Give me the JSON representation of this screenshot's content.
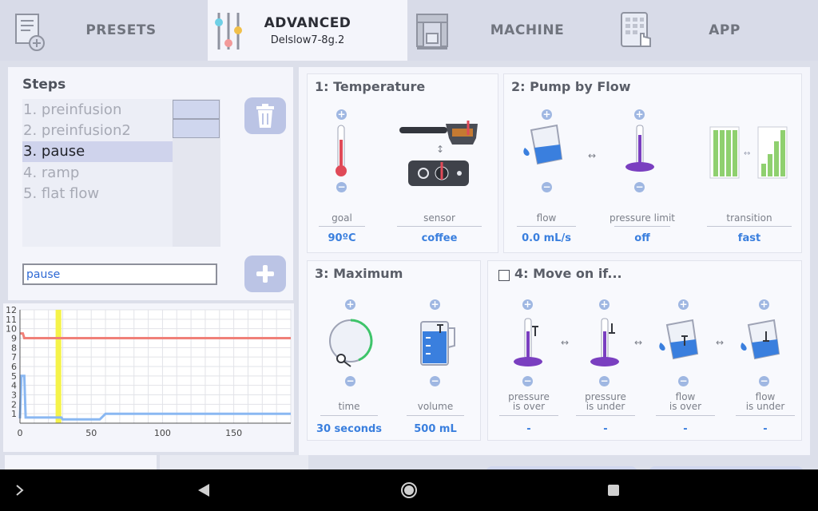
{
  "tabs": {
    "presets": "PRESETS",
    "advanced": "ADVANCED",
    "advanced_sub": "Delslow7-8g.2",
    "machine": "MACHINE",
    "app": "APP"
  },
  "steps": {
    "title": "Steps",
    "items": [
      "1. preinfusion",
      "2. preinfusion2",
      "3. pause",
      "4. ramp",
      "5. flat flow"
    ],
    "selected_index": 2,
    "name_value": "pause"
  },
  "temperature": {
    "title": "1: Temperature",
    "goal_label": "goal",
    "goal_value": "90ºC",
    "sensor_label": "sensor",
    "sensor_value": "coffee"
  },
  "pump": {
    "title": "2: Pump by Flow",
    "flow_label": "flow",
    "flow_value": "0.0 mL/s",
    "pressure_label": "pressure limit",
    "pressure_value": "off",
    "transition_label": "transition",
    "transition_value": "fast"
  },
  "maximum": {
    "title": "3: Maximum",
    "time_label": "time",
    "time_value": "30 seconds",
    "volume_label": "volume",
    "volume_value": "500 mL"
  },
  "moveon": {
    "title": "4: Move on if...",
    "checked": false,
    "items": [
      {
        "line1": "pressure",
        "line2": "is over",
        "value": "-"
      },
      {
        "line1": "pressure",
        "line2": "is under",
        "value": "-"
      },
      {
        "line1": "flow",
        "line2": "is over",
        "value": "-"
      },
      {
        "line1": "flow",
        "line2": "is under",
        "value": "-"
      }
    ]
  },
  "colors": {
    "accent": "#3a7fde",
    "temperature_line": "#f08078",
    "flow_line": "#8ab8f2",
    "highlight_band": "#f5f34a",
    "button": "#bbc4e5"
  },
  "chart_data": {
    "type": "line",
    "xlim": [
      0,
      190
    ],
    "ylim": [
      0,
      12
    ],
    "x_ticks": [
      0,
      50,
      100,
      150
    ],
    "y_ticks": [
      1,
      2,
      3,
      4,
      5,
      6,
      7,
      8,
      9,
      10,
      11,
      12
    ],
    "grid": true,
    "highlight_x": [
      25,
      29
    ],
    "series": [
      {
        "color": "#f08078",
        "points": [
          [
            0,
            9.5
          ],
          [
            2,
            9.5
          ],
          [
            3,
            9
          ],
          [
            190,
            9
          ]
        ]
      },
      {
        "color": "#8ab8f2",
        "points": [
          [
            0,
            0.5
          ],
          [
            1,
            5
          ],
          [
            3,
            5
          ],
          [
            4,
            0.6
          ],
          [
            29,
            0.6
          ],
          [
            30,
            0.4
          ],
          [
            56,
            0.4
          ],
          [
            60,
            1
          ],
          [
            190,
            1
          ]
        ]
      }
    ]
  }
}
